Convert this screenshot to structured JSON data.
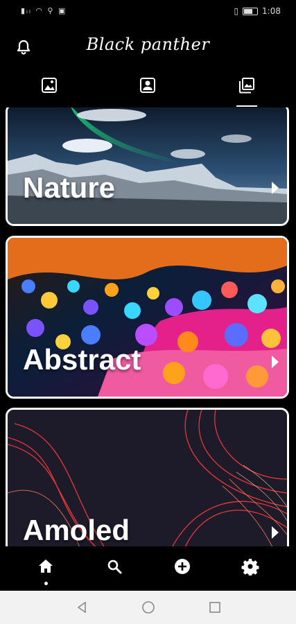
{
  "status_bar": {
    "left_icons": "sim signal wifi usb sim2",
    "time": "1:08",
    "colors": {
      "icons": "#dddddd"
    }
  },
  "header": {
    "title": "Black panther",
    "notification_icon": "bell-icon"
  },
  "tabs": [
    {
      "icon": "image-frame-icon",
      "selected": false
    },
    {
      "icon": "portrait-frame-icon",
      "selected": false
    },
    {
      "icon": "collections-icon",
      "selected": true
    }
  ],
  "categories": [
    {
      "label": "Nature",
      "arrow": "chevron-right-icon"
    },
    {
      "label": "Abstract",
      "arrow": "chevron-right-icon"
    },
    {
      "label": "Amoled",
      "arrow": "chevron-right-icon"
    }
  ],
  "bottom_nav": [
    {
      "icon": "home-icon",
      "active": true
    },
    {
      "icon": "search-icon",
      "active": false
    },
    {
      "icon": "add-circle-icon",
      "active": false
    },
    {
      "icon": "settings-gear-icon",
      "active": false
    }
  ],
  "system_nav": [
    "back-icon",
    "home-circle-icon",
    "recents-icon"
  ],
  "colors": {
    "background": "#000000",
    "foreground": "#ffffff",
    "system_nav": "#f2f2f2"
  }
}
